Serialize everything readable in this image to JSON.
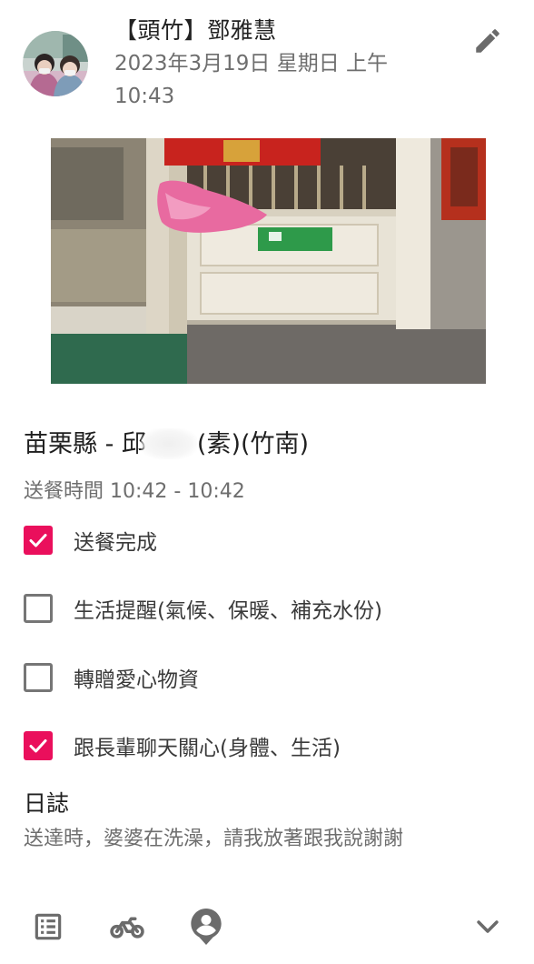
{
  "header": {
    "author": "【頭竹】鄧雅慧",
    "timestamp": "2023年3月19日 星期日 上午 10:43",
    "edit_icon": "pencil-icon",
    "avatar": "user-avatar-photo"
  },
  "photo": {
    "sign_text": "",
    "content": "door-with-pink-bag-photo"
  },
  "record": {
    "recipient_prefix": "苗栗縣 - 邱",
    "recipient_suffix": "(素)(竹南)",
    "delivery_time": "送餐時間 10:42 - 10:42"
  },
  "checklist": [
    {
      "label": "送餐完成",
      "checked": true
    },
    {
      "label": "生活提醒(氣候、保暖、補充水份)",
      "checked": false
    },
    {
      "label": "轉贈愛心物資",
      "checked": false
    },
    {
      "label": "跟長輩聊天關心(身體、生活)",
      "checked": true
    }
  ],
  "log": {
    "title": "日誌",
    "text": "送達時，婆婆在洗澡，請我放著跟我說謝謝"
  },
  "bottom_bar": {
    "icons": [
      "list-icon",
      "scooter-icon",
      "person-pin-icon",
      "chevron-down-icon"
    ]
  },
  "colors": {
    "accent": "#ea0f5c",
    "secondary_text": "#6e6e6e",
    "icon_gray": "#6b6b6b"
  }
}
